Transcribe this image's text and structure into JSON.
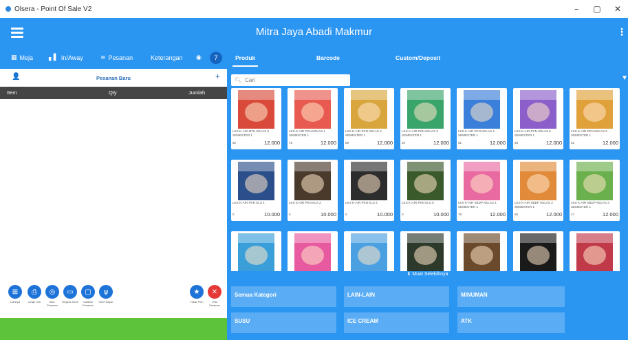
{
  "window": {
    "title": "Olsera - Point Of Sale V2",
    "controls": [
      "–",
      "▢",
      "✕"
    ]
  },
  "appbar": {
    "shop_name": "Mitra Jaya Abadi Makmur"
  },
  "toolbar": {
    "meja": "Meja",
    "inaway": "In/Away",
    "pesanan": "Pesanan",
    "keterangan": "Keterangan",
    "badge_count": "7"
  },
  "tabs": [
    {
      "label": "Produk",
      "active": true
    },
    {
      "label": "Barcode",
      "active": false
    },
    {
      "label": "Custom/Deposit",
      "active": false
    }
  ],
  "order": {
    "header": "Pesanan Baru",
    "plus": "+",
    "columns": {
      "item": "Item",
      "qty": "Qty",
      "jumlah": "Jumlah"
    }
  },
  "actions": [
    {
      "icon": "grid-icon",
      "label": "Lainnya"
    },
    {
      "icon": "print-icon",
      "label": "Cetak Cek"
    },
    {
      "icon": "view-icon",
      "label": "Disc. Pesanan"
    },
    {
      "icon": "truck-icon",
      "label": "Ongkos Kirim"
    },
    {
      "icon": "chat-icon",
      "label": "Catatan Pesanan"
    },
    {
      "icon": "kitchen-icon",
      "label": "Kirim Dapur"
    }
  ],
  "actions_right": [
    {
      "icon": "star-icon",
      "label": "Tukar Poin"
    },
    {
      "icon": "void-icon",
      "label": "Void Pesanan"
    }
  ],
  "search": {
    "placeholder": "Cari"
  },
  "products": [
    {
      "name": "LKS K-AIR MTK KELAS 6 SEMESTER 1",
      "stock": "92",
      "price": "12.000",
      "color": "#d94a3a"
    },
    {
      "name": "LKS K-AIR PKN KELAS 1 SEMESTER 1",
      "stock": "75",
      "price": "12.000",
      "color": "#e85a4f"
    },
    {
      "name": "LKS K-AIR PKN KELAS 2 SEMESTER 1",
      "stock": "89",
      "price": "12.000",
      "color": "#d9a63e"
    },
    {
      "name": "LKS K-AIR PKN KELAS 3 SEMESTER 1",
      "stock": "29",
      "price": "12.000",
      "color": "#3aa56b"
    },
    {
      "name": "LKS K-AIR PKN KELAS 4 SEMESTER 1",
      "stock": "61",
      "price": "12.000",
      "color": "#3a7fd9"
    },
    {
      "name": "LKS K-AIR PKN KELAS 5 SEMESTER 1",
      "stock": "93",
      "price": "12.000",
      "color": "#8a5fc9"
    },
    {
      "name": "LKS K-AIR PKN KELAS 6 SEMESTER 1",
      "stock": "61",
      "price": "12.000",
      "color": "#e0a03a"
    },
    {
      "name": "LKS K-AIR PKN KLS 1",
      "stock": "0",
      "price": "10.000",
      "color": "#2b4f8a"
    },
    {
      "name": "LKS K-AIR PKN KLS 2",
      "stock": "0",
      "price": "10.000",
      "color": "#4a3a2b"
    },
    {
      "name": "LKS K-AIR PKN KLS 4",
      "stock": "0",
      "price": "10.000",
      "color": "#2d2d2d"
    },
    {
      "name": "LKS K-AIR PKN KLS 5",
      "stock": "0",
      "price": "10.000",
      "color": "#3a5a2b"
    },
    {
      "name": "LKS K-AIR SBDP KELAS 1 SEMESTER 1",
      "stock": "79",
      "price": "12.000",
      "color": "#e86aa0"
    },
    {
      "name": "LKS K-AIR SBDP KELAS 2 SEMESTER 1",
      "stock": "89",
      "price": "12.000",
      "color": "#e08a3a"
    },
    {
      "name": "LKS K-AIR SBDP KELAS 3 SEMESTER 1",
      "stock": "47",
      "price": "12.000",
      "color": "#6ab04c"
    },
    {
      "name": "",
      "stock": "",
      "price": "",
      "color": "#3a9fd9"
    },
    {
      "name": "",
      "stock": "",
      "price": "",
      "color": "#e85a9f"
    },
    {
      "name": "",
      "stock": "",
      "price": "",
      "color": "#4aa0e0"
    },
    {
      "name": "",
      "stock": "",
      "price": "",
      "color": "#2d3a2b"
    },
    {
      "name": "",
      "stock": "",
      "price": "",
      "color": "#6a4a2b"
    },
    {
      "name": "",
      "stock": "",
      "price": "",
      "color": "#1a1a1a"
    },
    {
      "name": "",
      "stock": "",
      "price": "",
      "color": "#c03a4a"
    }
  ],
  "more_label": "Muat Selebihnya",
  "categories": [
    {
      "label": "Semua Kategori"
    },
    {
      "label": "LAIN-LAIN"
    },
    {
      "label": "MINUMAN"
    },
    {
      "label": "SUSU"
    },
    {
      "label": "ICE CREAM"
    },
    {
      "label": "ATK"
    }
  ]
}
